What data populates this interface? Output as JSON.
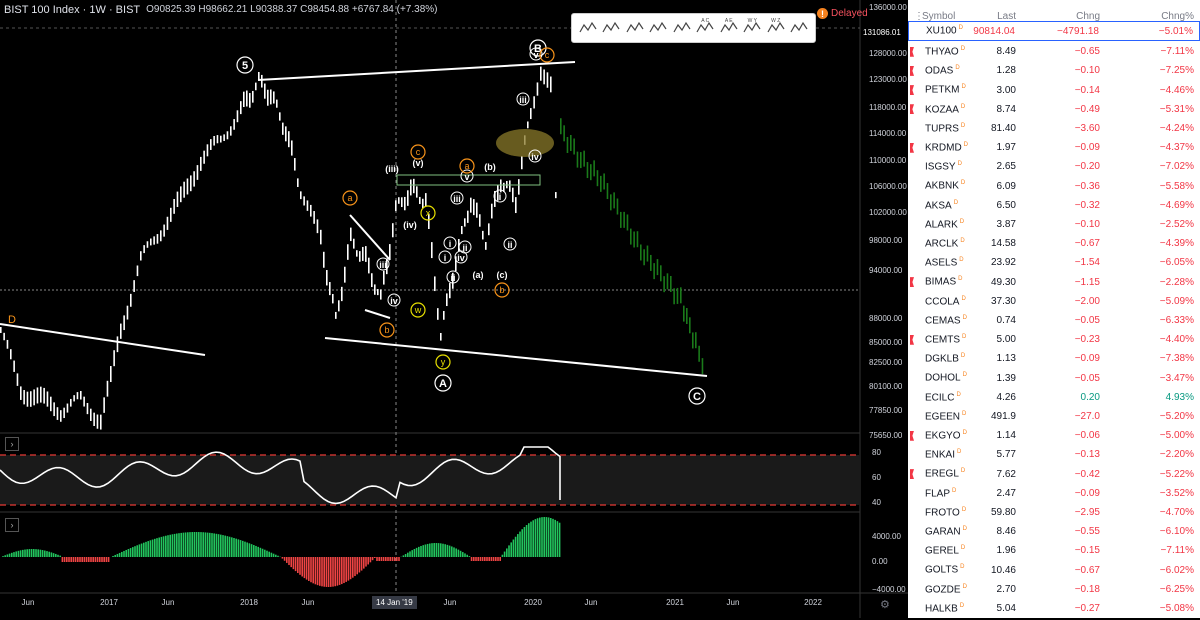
{
  "header": {
    "symbol": "BIST 100 Index · 1W · BIST",
    "ohlc": "O90825.39 H98662.21 L90388.37 C98454.88 +6767.84 (+7.38%)",
    "delayed": "Delayed",
    "delayed_icon": "!"
  },
  "colors": {
    "down": "#f23645",
    "up": "#089981",
    "accent": "#2962ff",
    "rsi_line": "#ffffff",
    "macd_up": "#22c55e",
    "macd_down": "#ef4444"
  },
  "toolbar": {
    "tools": [
      "head-shoulders-tool",
      "trend-pattern-tool",
      "abcd-pattern-tool",
      "text-lines-tool",
      "elliott-impulse-tool",
      "elliott-abc-tool",
      "elliott-abe-tool",
      "elliott-wxy-tool",
      "elliott-wxyxz-tool",
      "pen-tool"
    ],
    "tool_labels": [
      "",
      "",
      "",
      "",
      "",
      "A C",
      "A E",
      "W Y",
      "W Z",
      ""
    ]
  },
  "price_axis": {
    "labels": [
      "136000.00",
      "131086.01",
      "128000.00",
      "123000.00",
      "118000.00",
      "114000.00",
      "110000.00",
      "106000.00",
      "102000.00",
      "98000.00",
      "94000.00",
      "90819.40",
      "4d 8h",
      "88000.00",
      "85000.00",
      "82500.00",
      "80100.00",
      "77850.00",
      "75650.00"
    ],
    "rsi_labels": [
      "80",
      "60",
      "40"
    ],
    "macd_labels": [
      "4000.00",
      "0.00",
      "−4000.00"
    ]
  },
  "time_axis": {
    "labels": [
      "Jun",
      "2017",
      "Jun",
      "2018",
      "Jun",
      "Jun",
      "2020",
      "Jun",
      "2021",
      "Jun",
      "2022"
    ],
    "highlight": "14 Jan '19"
  },
  "annotations": {
    "white": [
      "5",
      "B",
      "A",
      "C",
      "(iii)",
      "(v)",
      "(iv)",
      "(b)",
      "(a)",
      "(c)",
      "v",
      "iii",
      "iv",
      "i",
      "ii",
      "v",
      "iv",
      "iii",
      "i",
      "ii",
      "iii",
      "iv",
      "ii",
      "i"
    ],
    "orange": [
      "a",
      "c",
      "a",
      "b",
      "b",
      "c"
    ],
    "yellow": [
      "x",
      "w",
      "y"
    ],
    "d_label": "D"
  },
  "watchlist": {
    "headers": {
      "symbol": "Symbol",
      "last": "Last",
      "chg": "Chng",
      "pct": "Chng%"
    },
    "rows": [
      {
        "s": "XU100",
        "l": "90814.04",
        "c": "−4791.18",
        "p": "−5.01%",
        "f": false,
        "sel": true,
        "up": false
      },
      {
        "s": "THYAO",
        "l": "8.49",
        "c": "−0.65",
        "p": "−7.11%",
        "f": true,
        "up": false
      },
      {
        "s": "ODAS",
        "l": "1.28",
        "c": "−0.10",
        "p": "−7.25%",
        "f": true,
        "up": false
      },
      {
        "s": "PETKM",
        "l": "3.00",
        "c": "−0.14",
        "p": "−4.46%",
        "f": true,
        "up": false
      },
      {
        "s": "KOZAA",
        "l": "8.74",
        "c": "−0.49",
        "p": "−5.31%",
        "f": true,
        "up": false
      },
      {
        "s": "TUPRS",
        "l": "81.40",
        "c": "−3.60",
        "p": "−4.24%",
        "f": false,
        "up": false
      },
      {
        "s": "KRDMD",
        "l": "1.97",
        "c": "−0.09",
        "p": "−4.37%",
        "f": true,
        "up": false
      },
      {
        "s": "ISGSY",
        "l": "2.65",
        "c": "−0.20",
        "p": "−7.02%",
        "f": false,
        "up": false
      },
      {
        "s": "AKBNK",
        "l": "6.09",
        "c": "−0.36",
        "p": "−5.58%",
        "f": false,
        "up": false
      },
      {
        "s": "AKSA",
        "l": "6.50",
        "c": "−0.32",
        "p": "−4.69%",
        "f": false,
        "up": false
      },
      {
        "s": "ALARK",
        "l": "3.87",
        "c": "−0.10",
        "p": "−2.52%",
        "f": false,
        "up": false
      },
      {
        "s": "ARCLK",
        "l": "14.58",
        "c": "−0.67",
        "p": "−4.39%",
        "f": false,
        "up": false
      },
      {
        "s": "ASELS",
        "l": "23.92",
        "c": "−1.54",
        "p": "−6.05%",
        "f": false,
        "up": false
      },
      {
        "s": "BIMAS",
        "l": "49.30",
        "c": "−1.15",
        "p": "−2.28%",
        "f": true,
        "up": false
      },
      {
        "s": "CCOLA",
        "l": "37.30",
        "c": "−2.00",
        "p": "−5.09%",
        "f": false,
        "up": false
      },
      {
        "s": "CEMAS",
        "l": "0.74",
        "c": "−0.05",
        "p": "−6.33%",
        "f": false,
        "up": false
      },
      {
        "s": "CEMTS",
        "l": "5.00",
        "c": "−0.23",
        "p": "−4.40%",
        "f": true,
        "up": false
      },
      {
        "s": "DGKLB",
        "l": "1.13",
        "c": "−0.09",
        "p": "−7.38%",
        "f": false,
        "up": false
      },
      {
        "s": "DOHOL",
        "l": "1.39",
        "c": "−0.05",
        "p": "−3.47%",
        "f": false,
        "up": false
      },
      {
        "s": "ECILC",
        "l": "4.26",
        "c": "0.20",
        "p": "4.93%",
        "f": false,
        "up": true
      },
      {
        "s": "EGEEN",
        "l": "491.9",
        "c": "−27.0",
        "p": "−5.20%",
        "f": false,
        "up": false
      },
      {
        "s": "EKGYO",
        "l": "1.14",
        "c": "−0.06",
        "p": "−5.00%",
        "f": true,
        "up": false
      },
      {
        "s": "ENKAI",
        "l": "5.77",
        "c": "−0.13",
        "p": "−2.20%",
        "f": false,
        "up": false
      },
      {
        "s": "EREGL",
        "l": "7.62",
        "c": "−0.42",
        "p": "−5.22%",
        "f": true,
        "up": false
      },
      {
        "s": "FLAP",
        "l": "2.47",
        "c": "−0.09",
        "p": "−3.52%",
        "f": false,
        "up": false
      },
      {
        "s": "FROTO",
        "l": "59.80",
        "c": "−2.95",
        "p": "−4.70%",
        "f": false,
        "up": false
      },
      {
        "s": "GARAN",
        "l": "8.46",
        "c": "−0.55",
        "p": "−6.10%",
        "f": false,
        "up": false
      },
      {
        "s": "GEREL",
        "l": "1.96",
        "c": "−0.15",
        "p": "−7.11%",
        "f": false,
        "up": false
      },
      {
        "s": "GOLTS",
        "l": "10.46",
        "c": "−0.67",
        "p": "−6.02%",
        "f": false,
        "up": false
      },
      {
        "s": "GOZDE",
        "l": "2.70",
        "c": "−0.18",
        "p": "−6.25%",
        "f": false,
        "up": false
      },
      {
        "s": "HALKB",
        "l": "5.04",
        "c": "−0.27",
        "p": "−5.08%",
        "f": false,
        "up": false
      }
    ]
  }
}
